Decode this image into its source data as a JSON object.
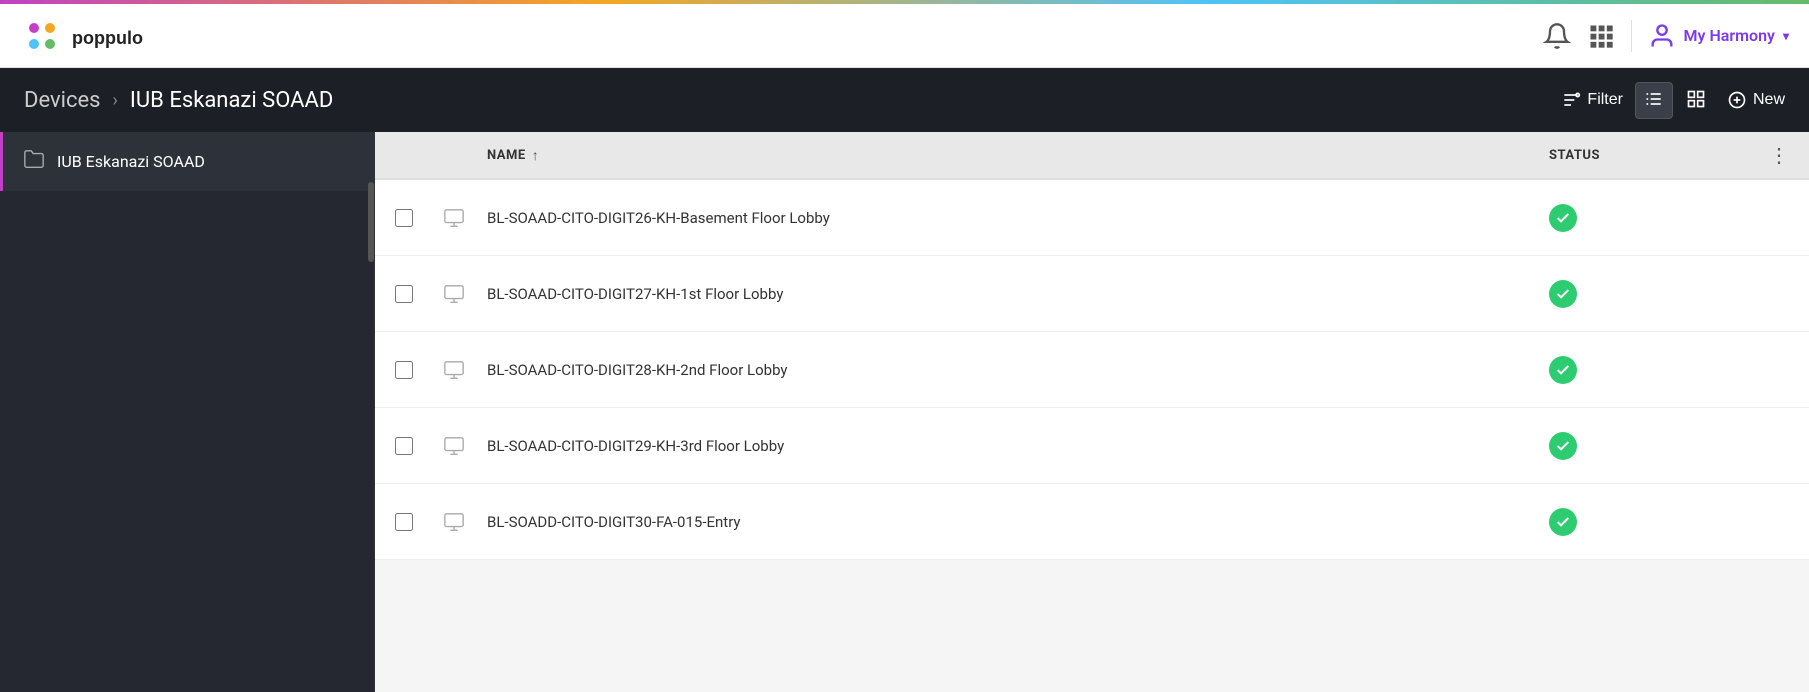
{
  "gradientBar": {},
  "header": {
    "logo_alt": "Poppulo",
    "user_label": "My Harmony",
    "notification_icon": "bell",
    "apps_icon": "grid",
    "user_icon": "user",
    "chevron_icon": "▾"
  },
  "subHeader": {
    "breadcrumb_parent": "Devices",
    "breadcrumb_separator": "›",
    "breadcrumb_current": "IUB Eskanazi SOAAD",
    "filter_label": "Filter",
    "new_label": "New",
    "view_list_icon": "list",
    "view_grid_icon": "grid",
    "more_icon": "⋮"
  },
  "sidebar": {
    "items": [
      {
        "label": "IUB Eskanazi SOAAD",
        "icon": "folder",
        "active": true
      }
    ]
  },
  "table": {
    "columns": {
      "name": "NAME",
      "status": "STATUS"
    },
    "rows": [
      {
        "id": 1,
        "name": "BL-SOAAD-CITO-DIGIT26-KH-Basement Floor Lobby",
        "status": "ok",
        "status_icon": "✓"
      },
      {
        "id": 2,
        "name": "BL-SOAAD-CITO-DIGIT27-KH-1st Floor Lobby",
        "status": "ok",
        "status_icon": "✓"
      },
      {
        "id": 3,
        "name": "BL-SOAAD-CITO-DIGIT28-KH-2nd Floor Lobby",
        "status": "ok",
        "status_icon": "✓"
      },
      {
        "id": 4,
        "name": "BL-SOAAD-CITO-DIGIT29-KH-3rd Floor Lobby",
        "status": "ok",
        "status_icon": "✓"
      },
      {
        "id": 5,
        "name": "BL-SOADD-CITO-DIGIT30-FA-015-Entry",
        "status": "ok",
        "status_icon": "✓"
      }
    ]
  }
}
